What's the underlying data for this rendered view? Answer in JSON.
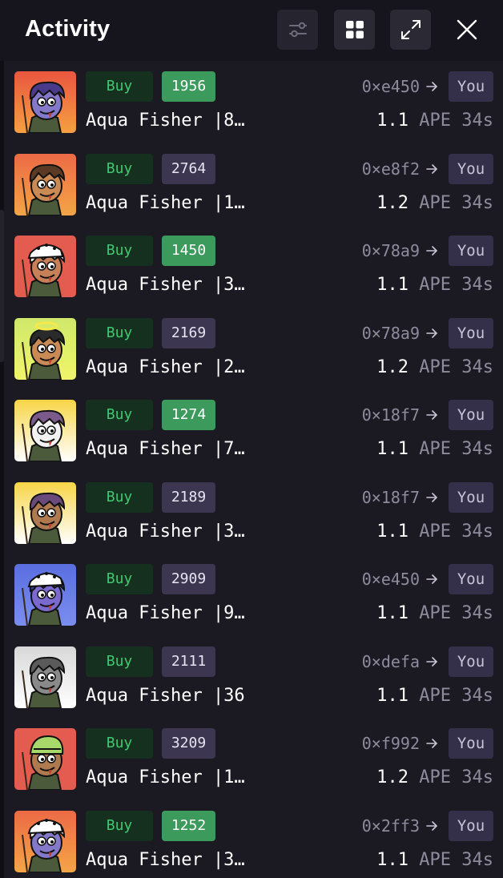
{
  "header": {
    "title": "Activity",
    "buttons": [
      {
        "icon": "sliders-icon"
      },
      {
        "icon": "grid-icon"
      },
      {
        "icon": "expand-icon"
      },
      {
        "icon": "close-icon"
      }
    ]
  },
  "colors": {
    "background": "#16151d",
    "list_background": "#1b1a23",
    "buy_text": "#3fc96f",
    "buy_bg": "#16301f",
    "token_green": "#3c9a5c",
    "token_purple": "#3c3650",
    "you_bg": "#35304a",
    "muted_text": "#8e8b9d"
  },
  "rows": [
    {
      "action": "Buy",
      "token_id": "1956",
      "token_style": "green",
      "name": "Aqua Fisher |8…",
      "from": "0×e450",
      "arrow_icon": "arrow-right-icon",
      "to": "You",
      "amount": "1.1",
      "currency": "APE",
      "age": "34s",
      "thumb": {
        "bg_top": "#e9563f",
        "bg_bottom": "#f5a042",
        "skin": "#8479c9",
        "hair": "#4a3a8a",
        "hat": "none"
      }
    },
    {
      "action": "Buy",
      "token_id": "2764",
      "token_style": "purple",
      "name": "Aqua Fisher |1…",
      "from": "0×e8f2",
      "arrow_icon": "arrow-right-icon",
      "to": "You",
      "amount": "1.2",
      "currency": "APE",
      "age": "34s",
      "thumb": {
        "bg_top": "#ec6a45",
        "bg_bottom": "#f4a547",
        "skin": "#c98a55",
        "hair": "#5a3a24",
        "hat": "none"
      }
    },
    {
      "action": "Buy",
      "token_id": "1450",
      "token_style": "green",
      "name": "Aqua Fisher |3…",
      "from": "0×78a9",
      "arrow_icon": "arrow-right-icon",
      "to": "You",
      "amount": "1.1",
      "currency": "APE",
      "age": "34s",
      "thumb": {
        "bg_top": "#e45c4f",
        "bg_bottom": "#e45c4f",
        "skin": "#c88058",
        "hair": "#ffffff",
        "hat": "cap"
      }
    },
    {
      "action": "Buy",
      "token_id": "2169",
      "token_style": "purple",
      "name": "Aqua Fisher |2…",
      "from": "0×78a9",
      "arrow_icon": "arrow-right-icon",
      "to": "You",
      "amount": "1.2",
      "currency": "APE",
      "age": "34s",
      "thumb": {
        "bg_top": "#cfe86a",
        "bg_bottom": "#f0f56a",
        "skin": "#c98a55",
        "hair": "#2a2a2a",
        "hat": "halo"
      }
    },
    {
      "action": "Buy",
      "token_id": "1274",
      "token_style": "green",
      "name": "Aqua Fisher |7…",
      "from": "0×18f7",
      "arrow_icon": "arrow-right-icon",
      "to": "You",
      "amount": "1.1",
      "currency": "APE",
      "age": "34s",
      "thumb": {
        "bg_top": "#f7d547",
        "bg_bottom": "#ffffff",
        "skin": "#f2f2f2",
        "hair": "#7a5a8a",
        "hat": "none"
      }
    },
    {
      "action": "Buy",
      "token_id": "2189",
      "token_style": "purple",
      "name": "Aqua Fisher |3…",
      "from": "0×18f7",
      "arrow_icon": "arrow-right-icon",
      "to": "You",
      "amount": "1.1",
      "currency": "APE",
      "age": "34s",
      "thumb": {
        "bg_top": "#f7d547",
        "bg_bottom": "#ffffff",
        "skin": "#b07a50",
        "hair": "#6a4a7a",
        "hat": "none"
      }
    },
    {
      "action": "Buy",
      "token_id": "2909",
      "token_style": "purple",
      "name": "Aqua Fisher |9…",
      "from": "0×e450",
      "arrow_icon": "arrow-right-icon",
      "to": "You",
      "amount": "1.1",
      "currency": "APE",
      "age": "34s",
      "thumb": {
        "bg_top": "#5a6ee0",
        "bg_bottom": "#7a8ef0",
        "skin": "#7a6ad0",
        "hair": "#3a3a8a",
        "hat": "cap"
      }
    },
    {
      "action": "Buy",
      "token_id": "2111",
      "token_style": "purple",
      "name": "Aqua Fisher |36",
      "from": "0×defa",
      "arrow_icon": "arrow-right-icon",
      "to": "You",
      "amount": "1.1",
      "currency": "APE",
      "age": "34s",
      "thumb": {
        "bg_top": "#d8d8d8",
        "bg_bottom": "#ffffff",
        "skin": "#8a8a8a",
        "hair": "#5a5a5a",
        "hat": "none"
      }
    },
    {
      "action": "Buy",
      "token_id": "3209",
      "token_style": "purple",
      "name": "Aqua Fisher |1…",
      "from": "0×f992",
      "arrow_icon": "arrow-right-icon",
      "to": "You",
      "amount": "1.2",
      "currency": "APE",
      "age": "34s",
      "thumb": {
        "bg_top": "#e45c4f",
        "bg_bottom": "#e45c4f",
        "skin": "#b07a50",
        "hair": "#a8d86a",
        "hat": "helmet"
      }
    },
    {
      "action": "Buy",
      "token_id": "1252",
      "token_style": "green",
      "name": "Aqua Fisher |3…",
      "from": "0×2ff3",
      "arrow_icon": "arrow-right-icon",
      "to": "You",
      "amount": "1.1",
      "currency": "APE",
      "age": "34s",
      "thumb": {
        "bg_top": "#ec6a45",
        "bg_bottom": "#f4a547",
        "skin": "#8479c9",
        "hair": "#ffffff",
        "hat": "cap"
      }
    }
  ]
}
